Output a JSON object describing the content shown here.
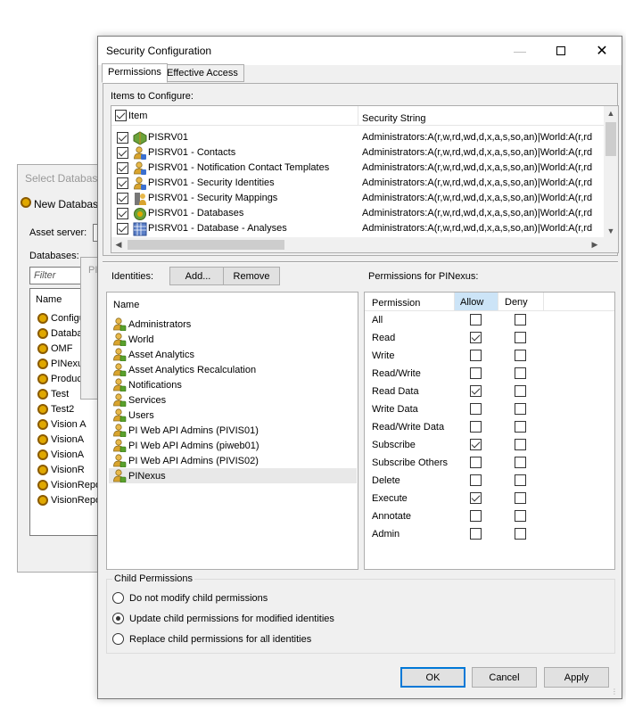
{
  "background": {
    "select_db_title": "Select Database",
    "new_database": "New Database",
    "asset_server_label": "Asset server:",
    "databases_label": "Databases:",
    "filter_placeholder": "Filter",
    "name_header": "Name",
    "db_items": [
      "Configu",
      "Databa",
      "OMF",
      "PINexu",
      "Produc",
      "Test",
      "Test2",
      "Vision A",
      "VisionA",
      "VisionA",
      "VisionR",
      "VisionRepo",
      "VisionRepo"
    ],
    "second_window_title": "PI"
  },
  "dialog": {
    "title": "Security Configuration",
    "tabs": [
      "Permissions",
      "Effective Access"
    ],
    "items_label": "Items to Configure:",
    "item_col": "Item",
    "security_col": "Security String",
    "items": [
      {
        "name": "PISRV01",
        "security": "Administrators:A(r,w,rd,wd,d,x,a,s,so,an)|World:A(r,rd",
        "checked": true,
        "icon": "server-icon"
      },
      {
        "name": "PISRV01 - Contacts",
        "security": "Administrators:A(r,w,rd,wd,d,x,a,s,so,an)|World:A(r,rd",
        "checked": true,
        "icon": "contacts-icon"
      },
      {
        "name": "PISRV01 - Notification Contact Templates",
        "security": "Administrators:A(r,w,rd,wd,d,x,a,s,so,an)|World:A(r,rd",
        "checked": true,
        "icon": "notification-templates-icon"
      },
      {
        "name": "PISRV01 - Security Identities",
        "security": "Administrators:A(r,w,rd,wd,d,x,a,s,so,an)|World:A(r,rd",
        "checked": true,
        "icon": "security-identities-icon"
      },
      {
        "name": "PISRV01 - Security Mappings",
        "security": "Administrators:A(r,w,rd,wd,d,x,a,s,so,an)|World:A(r,rd",
        "checked": true,
        "icon": "security-mappings-icon"
      },
      {
        "name": "PISRV01 - Databases",
        "security": "Administrators:A(r,w,rd,wd,d,x,a,s,so,an)|World:A(r,rd",
        "checked": true,
        "icon": "databases-icon"
      },
      {
        "name": "PISRV01 - Database - Analyses",
        "security": "Administrators:A(r,w,rd,wd,d,x,a,s,so,an)|World:A(r,rd",
        "checked": true,
        "icon": "analyses-icon"
      }
    ],
    "identities_label": "Identities:",
    "add_label": "Add...",
    "remove_label": "Remove",
    "name_header": "Name",
    "identities": [
      "Administrators",
      "World",
      "Asset Analytics",
      "Asset Analytics Recalculation",
      "Notifications",
      "Services",
      "Users",
      "PI Web API Admins (PIVIS01)",
      "PI Web API Admins (piweb01)",
      "PI Web API Admins (PIVIS02)",
      "PINexus"
    ],
    "selected_identity": "PINexus",
    "permissions_for_label": "Permissions for PINexus:",
    "perm_headers": {
      "permission": "Permission",
      "allow": "Allow",
      "deny": "Deny"
    },
    "permissions": [
      {
        "name": "All",
        "allow": false,
        "deny": false
      },
      {
        "name": "Read",
        "allow": true,
        "deny": false
      },
      {
        "name": "Write",
        "allow": false,
        "deny": false
      },
      {
        "name": "Read/Write",
        "allow": false,
        "deny": false
      },
      {
        "name": "Read Data",
        "allow": true,
        "deny": false
      },
      {
        "name": "Write Data",
        "allow": false,
        "deny": false
      },
      {
        "name": "Read/Write Data",
        "allow": false,
        "deny": false
      },
      {
        "name": "Subscribe",
        "allow": true,
        "deny": false
      },
      {
        "name": "Subscribe Others",
        "allow": false,
        "deny": false
      },
      {
        "name": "Delete",
        "allow": false,
        "deny": false
      },
      {
        "name": "Execute",
        "allow": true,
        "deny": false
      },
      {
        "name": "Annotate",
        "allow": false,
        "deny": false
      },
      {
        "name": "Admin",
        "allow": false,
        "deny": false
      }
    ],
    "child_permissions": {
      "legend": "Child Permissions",
      "options": [
        "Do not modify child permissions",
        "Update child permissions for modified identities",
        "Replace child permissions for all identities"
      ],
      "selected_index": 1
    },
    "ok_label": "OK",
    "cancel_label": "Cancel",
    "apply_label": "Apply"
  },
  "colors": {
    "accent": "#0078d7",
    "allow_header": "#cce4f7",
    "selection": "#e8e8e8"
  }
}
